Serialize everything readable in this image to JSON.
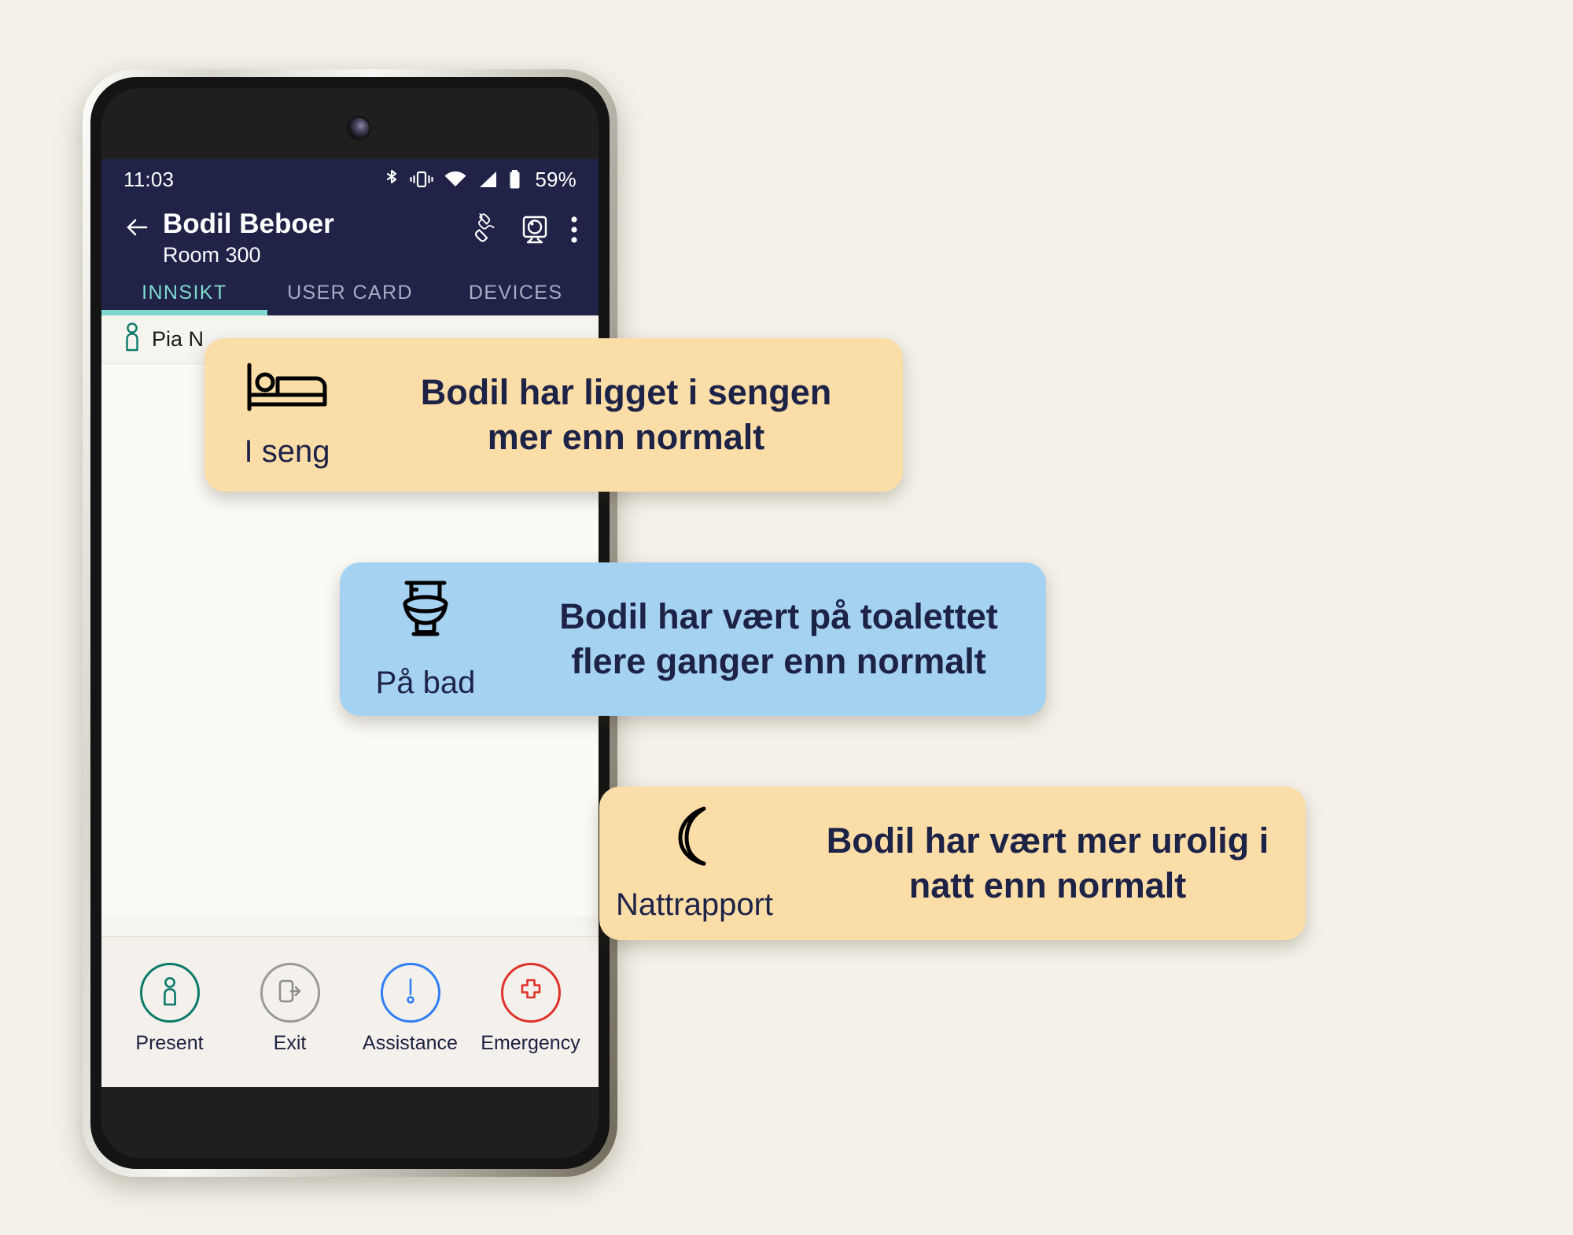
{
  "status_bar": {
    "time": "11:03",
    "battery_percent": "59%",
    "icons": [
      "bluetooth-icon",
      "vibrate-icon",
      "wifi-icon",
      "cellular-signal-icon",
      "battery-icon"
    ]
  },
  "header": {
    "back_icon": "back-arrow-icon",
    "name": "Bodil Beboer",
    "room": "Room 300",
    "actions": [
      "call-icon",
      "camera-icon",
      "overflow-menu-icon"
    ],
    "background": "#202347"
  },
  "tabs": [
    {
      "label": "INNSIKT",
      "active": true
    },
    {
      "label": "USER CARD",
      "active": false
    },
    {
      "label": "DEVICES",
      "active": false
    }
  ],
  "accent": {
    "teal": "#7fd8cd",
    "navy": "#1d2247"
  },
  "resident": {
    "icon": "person-icon",
    "name": "Pia N"
  },
  "cards": [
    {
      "icon": "bed-icon",
      "category": "I seng",
      "message": "Bodil har ligget i sengen mer enn normalt",
      "color": "#fbdda7"
    },
    {
      "icon": "toilet-icon",
      "category": "På bad",
      "message": "Bodil har vært på toalettet flere ganger enn normalt",
      "color": "#a6d2f2"
    },
    {
      "icon": "moon-icon",
      "category": "Nattrapport",
      "message": "Bodil har vært mer urolig i natt enn normalt",
      "color": "#fbdda7"
    }
  ],
  "action_bar": [
    {
      "label": "Present",
      "icon": "person-icon",
      "color": "#0a7a6a"
    },
    {
      "label": "Exit",
      "icon": "exit-door-icon",
      "color": "#9a9a9a"
    },
    {
      "label": "Assistance",
      "icon": "exclamation-icon",
      "color": "#2f7ef5"
    },
    {
      "label": "Emergency",
      "icon": "medical-cross-icon",
      "color": "#e0322b"
    }
  ]
}
